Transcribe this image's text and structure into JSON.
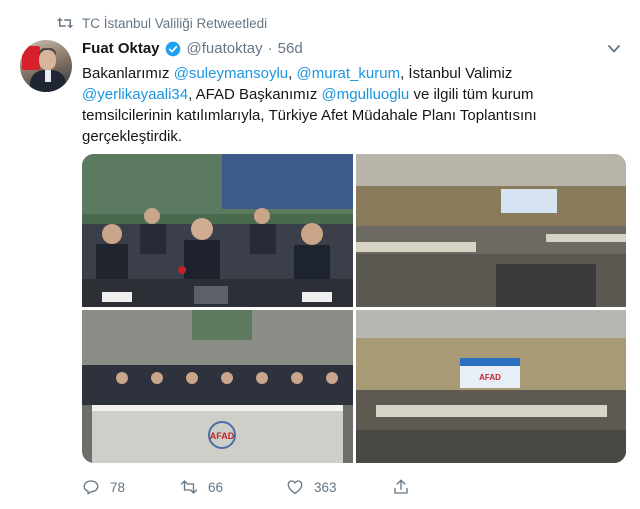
{
  "retweet": {
    "text": "TC İstanbul Valiliği Retweetledi"
  },
  "tweet": {
    "name": "Fuat Oktay",
    "handle": "@fuatoktay",
    "separator": "·",
    "time": "56d",
    "text": {
      "p1": "Bakanlarımız ",
      "m1": "@suleymansoylu",
      "p2": ", ",
      "m2": "@murat_kurum",
      "p3": ", İstanbul Valimiz ",
      "m3": "@yerlikayaali34",
      "p4": ", AFAD Başkanımız ",
      "m4": "@mgulluoglu",
      "p5": " ve ilgili tüm kurum temsilcilerinin katılımlarıyla, Türkiye Afet Müdahale Planı Toplantısını gerçekleştirdik."
    },
    "media": {
      "count": 4,
      "screen_text": "AFAD"
    },
    "stats": {
      "replies": "78",
      "retweets": "66",
      "likes": "363"
    }
  },
  "colors": {
    "link": "#1b95e0",
    "muted": "#657786",
    "text": "#14171a"
  },
  "icons": [
    "retweet-icon",
    "verified-badge-icon",
    "chevron-down-icon",
    "reply-icon",
    "retweet-icon",
    "heart-icon",
    "share-icon"
  ]
}
